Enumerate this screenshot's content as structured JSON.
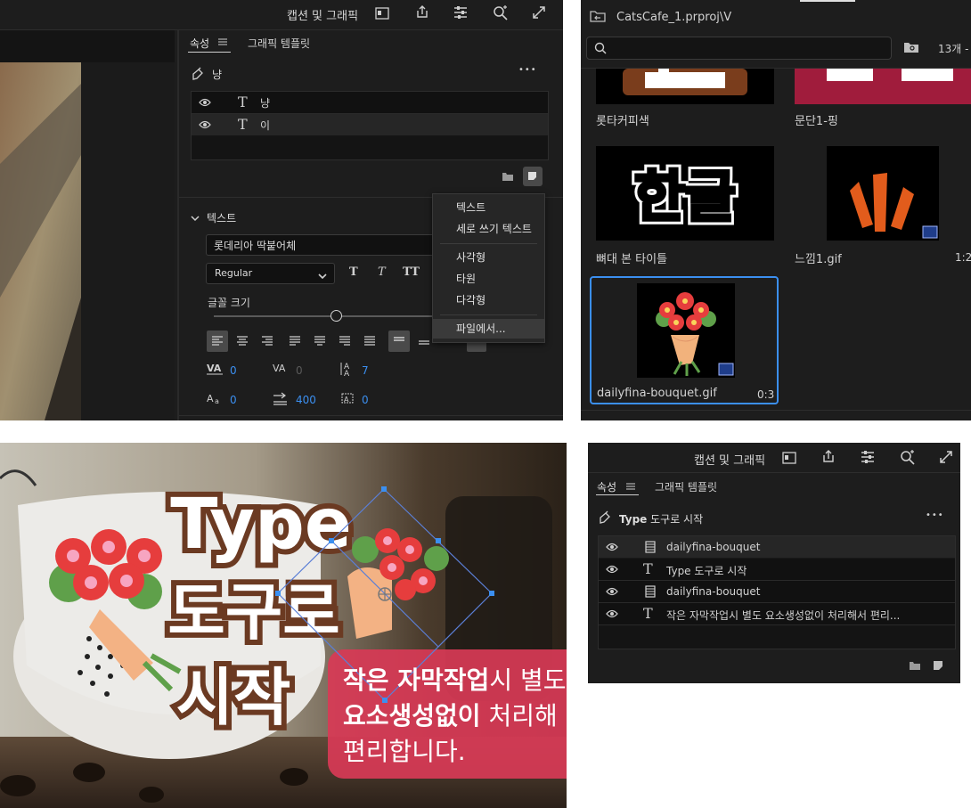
{
  "panel1": {
    "toolbar": {
      "title": "캡션 및 그래픽"
    },
    "tabs": [
      {
        "label": "속성"
      },
      {
        "label": "그래픽 템플릿"
      }
    ],
    "header_title": "냥",
    "more": "•••",
    "layers": [
      {
        "label": "냥"
      },
      {
        "label": "이"
      }
    ],
    "section": {
      "title": "텍스트"
    },
    "font": {
      "family": "롯데리아 딱붙어체",
      "style": "Regular"
    },
    "style_buttons": [
      "T",
      "T",
      "TT"
    ],
    "font_size_label": "글꼴 크기",
    "metrics": {
      "kerning": "0",
      "tracking": "0",
      "leading": "7",
      "baseline": "0",
      "tsume": "400",
      "indent": "0"
    },
    "menu": {
      "items": [
        "텍스트",
        "세로 쓰기 텍스트",
        "사각형",
        "타원",
        "다각형",
        "파일에서..."
      ]
    }
  },
  "panel2": {
    "breadcrumb": "CatsCafe_1.prproj\\V",
    "count": "13개 -",
    "items": [
      {
        "label": "롯타커피색"
      },
      {
        "label": "문단1-핑"
      },
      {
        "label": "뼈대 본 타이틀"
      },
      {
        "label": "느낌1.gif",
        "duration": "1:2"
      },
      {
        "label": "dailyfina-bouquet.gif",
        "duration": "0:3"
      }
    ],
    "thumb_text": "한글"
  },
  "panel3": {
    "title_lines": [
      "Type",
      "도구로",
      "시작"
    ],
    "caption": {
      "line1_bold": "작은 자막작업",
      "line1_rest": "시 별도",
      "line2_bold": "요소생성없이",
      "line2_rest": " 처리해",
      "line3": "편리합니다."
    }
  },
  "panel4": {
    "toolbar": {
      "title": "캡션 및 그래픽"
    },
    "tabs": [
      {
        "label": "속성"
      },
      {
        "label": "그래픽 템플릿"
      }
    ],
    "header": {
      "bold": "Type",
      "rest": " 도구로 시작"
    },
    "more": "•••",
    "layers": [
      {
        "label": "dailyfina-bouquet",
        "type": "film"
      },
      {
        "label": "Type  도구로 시작",
        "type": "text"
      },
      {
        "label": "dailyfina-bouquet",
        "type": "film"
      },
      {
        "label": "작은 자막작업시 별도 요소생성없이 처리해서 편리...",
        "type": "text"
      }
    ]
  },
  "colors": {
    "panel_bg": "#1d1d1d",
    "accent": "#3b8ff0",
    "caption_bg": "#d83a56",
    "title_brown": "#6b3a22"
  }
}
